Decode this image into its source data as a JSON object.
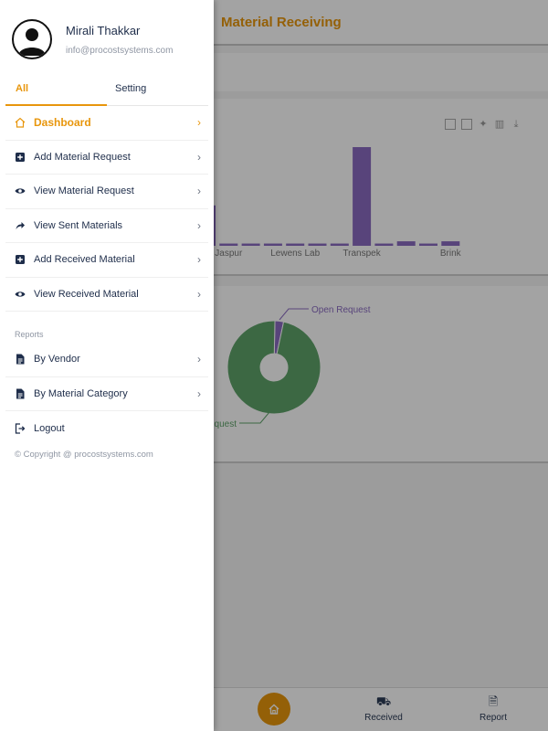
{
  "app": {
    "title": "Material Receiving",
    "accent_color": "#e8960c",
    "bottom_nav": [
      {
        "label": "",
        "icon": "home-icon"
      },
      {
        "label": "Received",
        "icon": "truck-icon"
      },
      {
        "label": "Report",
        "icon": "document-icon"
      }
    ]
  },
  "chart_data": [
    {
      "type": "bar",
      "categories": [
        "",
        "Jaspur",
        "",
        "",
        "Lewens Lab",
        "",
        "",
        "Transpek",
        "",
        "",
        "",
        "Brink"
      ],
      "tick_labels": [
        "Jaspur",
        "Lewens Lab",
        "Transpek",
        "Brink"
      ],
      "values": [
        18,
        1,
        1,
        1,
        1,
        1,
        1,
        44,
        1,
        2,
        1,
        2
      ],
      "series_color": "#8a6bc1",
      "toolbar_icons": [
        "zoom-box-icon",
        "reset-box-icon",
        "magic-icon",
        "bar-chart-icon",
        "download-icon"
      ]
    },
    {
      "type": "pie",
      "slices": [
        {
          "label": "Open Request",
          "value": 3,
          "color": "#8a6bc1"
        },
        {
          "label": "quest",
          "value": 97,
          "color": "#5fa36a"
        }
      ]
    }
  ],
  "drawer": {
    "user": {
      "name": "Mirali Thakkar",
      "email": "info@procostsystems.com"
    },
    "tabs": [
      {
        "label": "All",
        "active": true
      },
      {
        "label": "Setting",
        "active": false
      }
    ],
    "menu": [
      {
        "label": "Dashboard",
        "icon": "home-icon",
        "active": true
      },
      {
        "label": "Add Material Request",
        "icon": "plus-box-icon"
      },
      {
        "label": "View Material Request",
        "icon": "eye-icon"
      },
      {
        "label": "View Sent Materials",
        "icon": "share-arrow-icon"
      },
      {
        "label": "Add Received Material",
        "icon": "plus-box-icon"
      },
      {
        "label": "View Received Material",
        "icon": "eye-icon"
      }
    ],
    "reports_label": "Reports",
    "reports": [
      {
        "label": "By Vendor",
        "icon": "document-icon"
      },
      {
        "label": "By Material Category",
        "icon": "document-icon"
      }
    ],
    "logout_label": "Logout",
    "copyright": "© Copyright @ procostsystems.com"
  }
}
